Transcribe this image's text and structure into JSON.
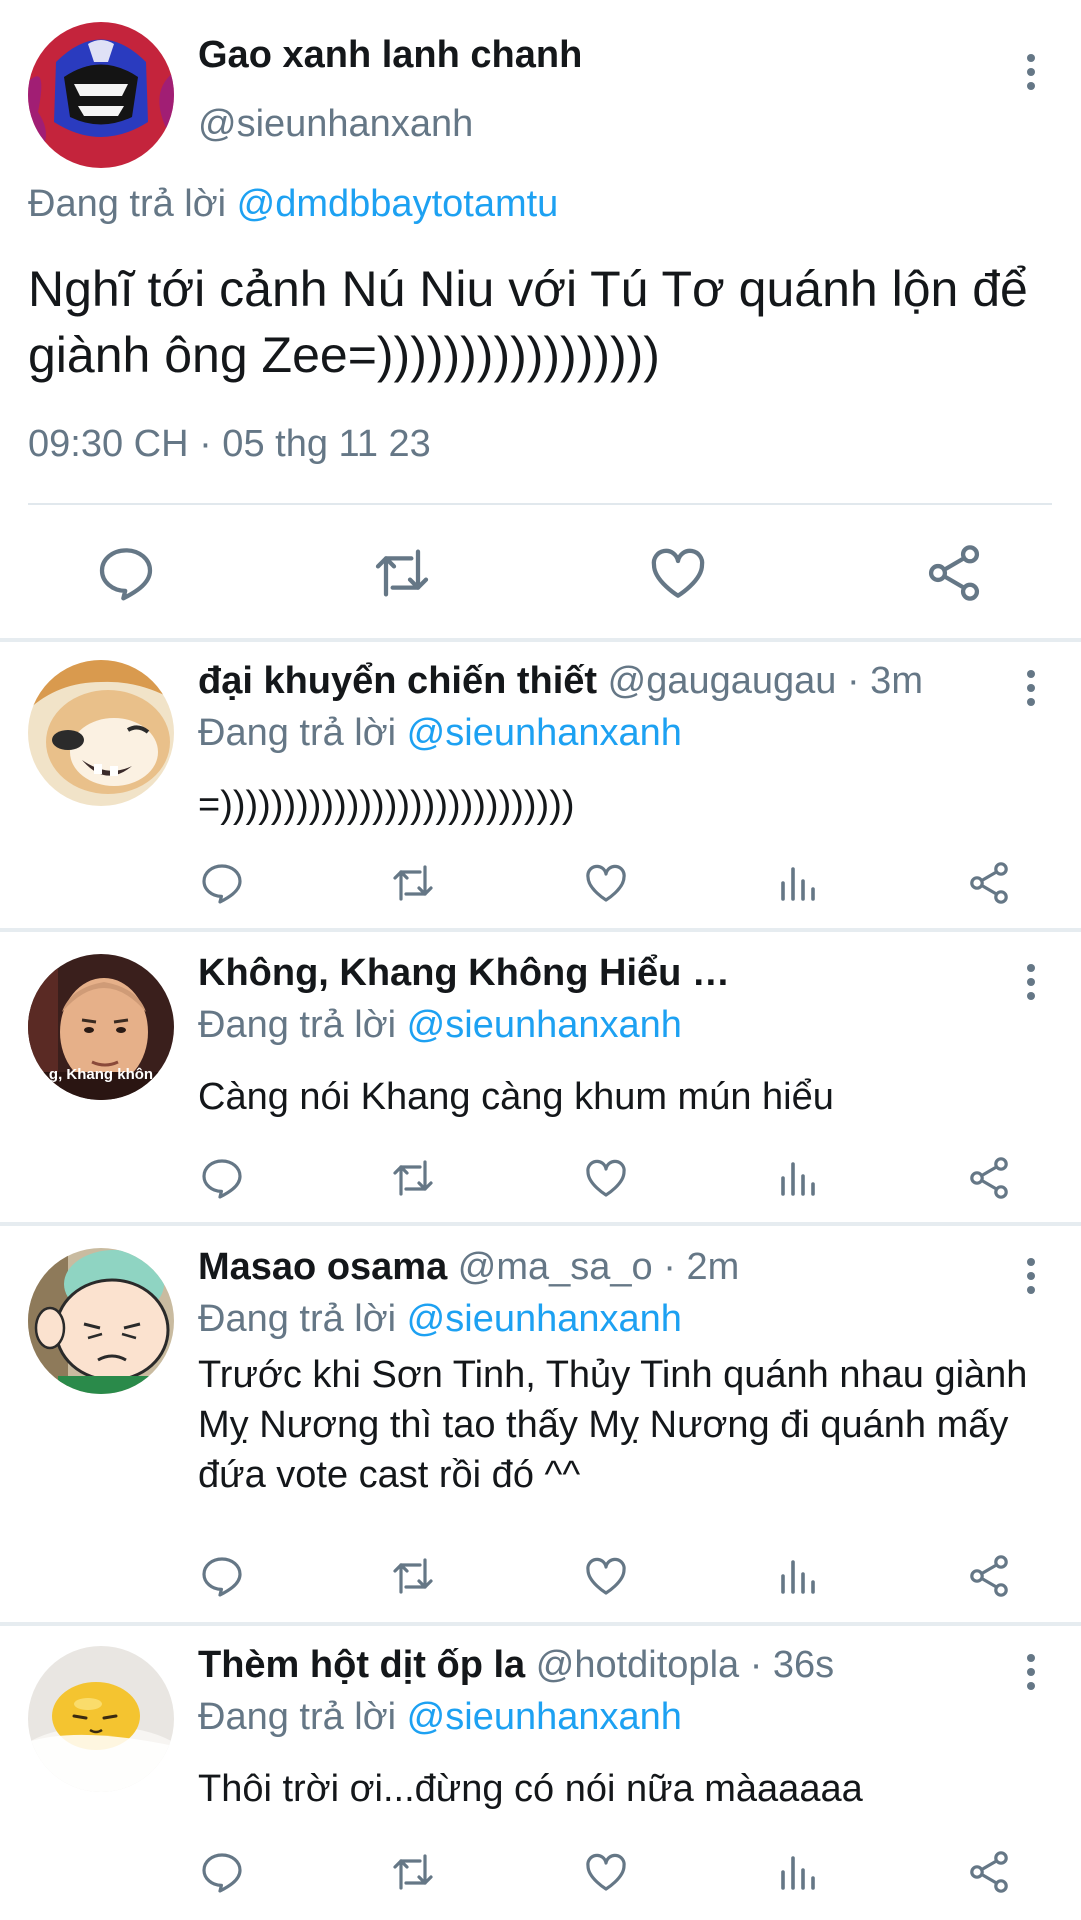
{
  "main_tweet": {
    "name": "Gao xanh lanh chanh",
    "handle": "@sieunhanxanh",
    "replying_prefix": "Đang trả lời ",
    "replying_to": "@dmdbbaytotamtu",
    "text": "Nghĩ tới cảnh Nú Niu với Tú Tơ quánh lộn để giành ông Zee=)))))))))))))))))",
    "timestamp": "09:30 CH · 05 thg 11 23",
    "actions": [
      "reply-icon",
      "retweet-icon",
      "like-icon",
      "share-icon"
    ]
  },
  "replies": [
    {
      "name": "đại khuyển chiến thiết",
      "handle_time": " @gaugaugau · 3m",
      "replying_prefix": "Đang trả lời ",
      "replying_to": "@sieunhanxanh",
      "text": "=))))))))))))))))))))))))))))",
      "avatar_desc": "shiba-dog-avatar"
    },
    {
      "name": "Không, Khang Không Hiểu …",
      "handle_time": "",
      "replying_prefix": "Đang trả lời ",
      "replying_to": "@sieunhanxanh",
      "text": "Càng nói Khang càng khum mún hiểu",
      "avatar_caption": "g, Khang khôn",
      "avatar_desc": "bald-man-avatar"
    },
    {
      "name": "Masao osama",
      "handle_time": " @ma_sa_o · 2m",
      "replying_prefix": "Đang trả lời ",
      "replying_to": "@sieunhanxanh",
      "text": "Trước khi Sơn Tinh, Thủy Tinh quánh nhau giành Mỵ Nương thì tao thấy Mỵ Nương đi quánh mấy đứa vote cast rồi đó ^^",
      "avatar_desc": "cartoon-boy-avatar"
    },
    {
      "name": "Thèm hột dịt ốp la",
      "handle_time": " @hotditopla · 36s",
      "replying_prefix": "Đang trả lời ",
      "replying_to": "@sieunhanxanh",
      "text": "Thôi trời ơi...đừng có nói nữa màaaaaa",
      "avatar_desc": "egg-yolk-avatar"
    }
  ],
  "colors": {
    "accent": "#1da1f2",
    "secondary_text": "#657786",
    "primary_text": "#14171a",
    "divider": "#e6ecf0"
  }
}
